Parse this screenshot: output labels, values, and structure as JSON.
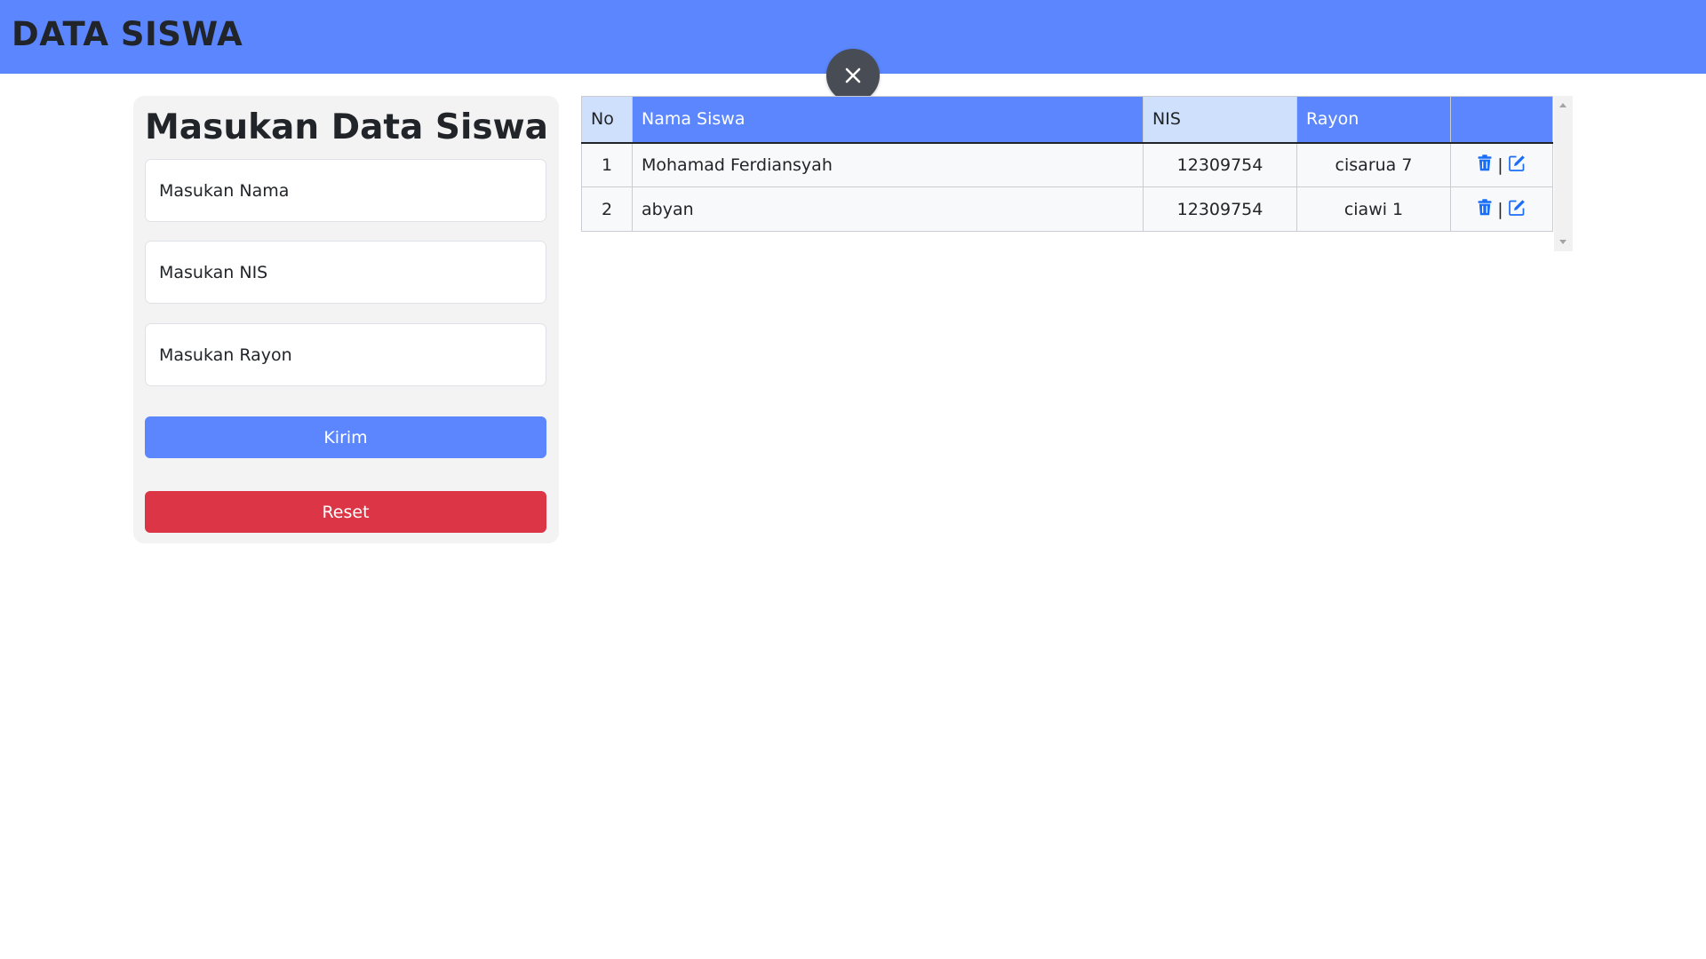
{
  "header": {
    "title": "DATA SISWA"
  },
  "form": {
    "title": "Masukan Data Siswa",
    "nama_placeholder": "Masukan Nama",
    "nis_placeholder": "Masukan NIS",
    "rayon_placeholder": "Masukan Rayon",
    "submit_label": "Kirim",
    "reset_label": "Reset"
  },
  "table": {
    "headers": {
      "no": "No",
      "nama": "Nama Siswa",
      "nis": "NIS",
      "rayon": "Rayon"
    },
    "rows": [
      {
        "no": "1",
        "nama": "Mohamad Ferdiansyah",
        "nis": "12309754",
        "rayon": "cisarua 7"
      },
      {
        "no": "2",
        "nama": "abyan",
        "nis": "12309754",
        "rayon": "ciawi 1"
      }
    ],
    "action_separator": "|"
  },
  "icons": {
    "close": "close-icon",
    "delete": "trash-icon",
    "edit": "edit-icon"
  },
  "colors": {
    "primary": "#5b86fd",
    "primary_light": "#cfe0fd",
    "danger": "#dc3545",
    "action_icon": "#1a6ef5",
    "close_button": "#474c55"
  }
}
